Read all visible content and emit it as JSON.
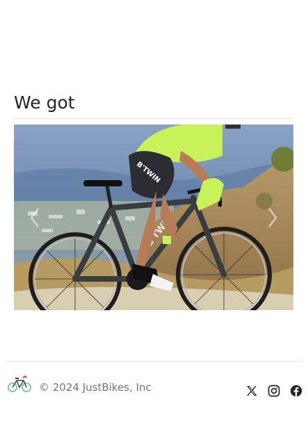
{
  "section": {
    "title": "We got"
  },
  "carousel": {
    "image_subject": "road cyclist riding a B'TWIN road bike",
    "frame_text": "B'TWIN",
    "prev_icon": "chevron-left-icon",
    "next_icon": "chevron-right-icon"
  },
  "footer": {
    "logo_icon": "bicycle-icon",
    "copyright": "© 2024 JustBikes, Inc",
    "social": [
      {
        "name": "x-twitter-icon"
      },
      {
        "name": "instagram-icon"
      },
      {
        "name": "facebook-icon"
      }
    ]
  },
  "colors": {
    "text": "#212529",
    "muted": "#6c757d",
    "rule": "#dee2e6",
    "jersey": "#c9f25a",
    "logo_green": "#7ec8a9"
  }
}
